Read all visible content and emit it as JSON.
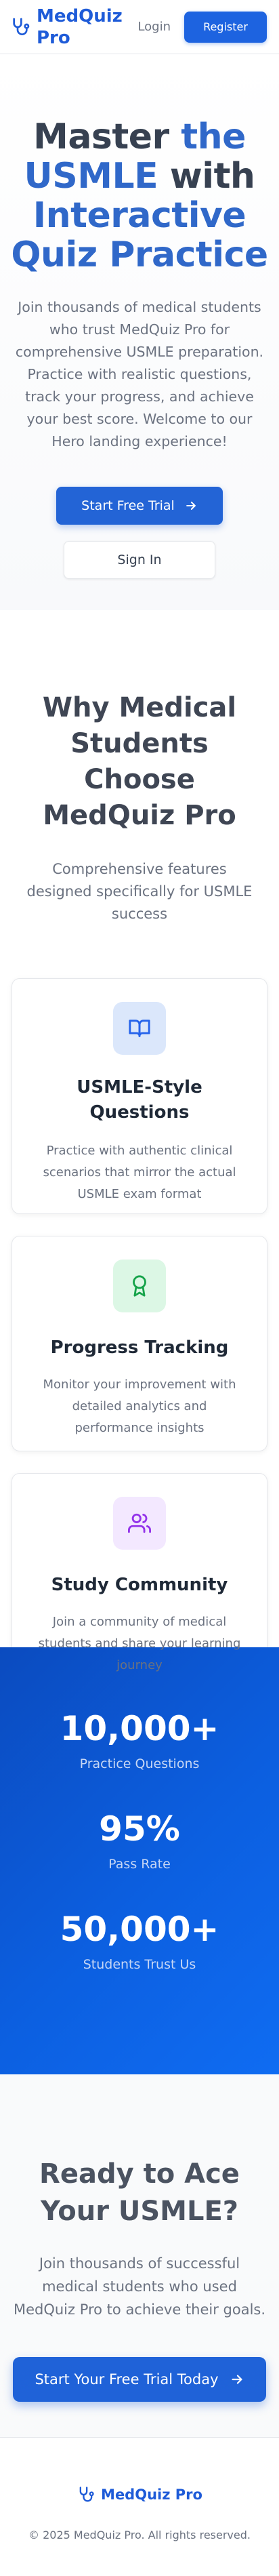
{
  "header": {
    "brand_name": "MedQuiz Pro",
    "login_label": "Login",
    "register_label": "Register"
  },
  "hero": {
    "title_line1_a": "Master ",
    "title_line1_b": "the",
    "title_line2_a": "USMLE",
    "title_line2_b": " with",
    "title_line3": "Interactive",
    "title_line4": "Quiz Practice",
    "subtitle": "Join thousands of medical students who trust MedQuiz Pro for comprehensive USMLE preparation. Practice with realistic questions, track your progress, and achieve your best score. Welcome to our Hero landing experience!",
    "primary_cta": "Start Free Trial",
    "secondary_cta": "Sign In"
  },
  "features": {
    "title": "Why Medical Students Choose MedQuiz Pro",
    "subtitle": "Comprehensive features designed specifically for USMLE success",
    "cards": [
      {
        "icon": "book-open-icon",
        "title": "USMLE-Style Questions",
        "description": "Practice with authentic clinical scenarios that mirror the actual USMLE exam format"
      },
      {
        "icon": "award-icon",
        "title": "Progress Tracking",
        "description": "Monitor your improvement with detailed analytics and performance insights"
      },
      {
        "icon": "users-icon",
        "title": "Study Community",
        "description": "Join a community of medical students and share your learning journey"
      }
    ]
  },
  "stats": [
    {
      "value": "10,000+",
      "label": "Practice Questions"
    },
    {
      "value": "95%",
      "label": "Pass Rate"
    },
    {
      "value": "50,000+",
      "label": "Students Trust Us"
    }
  ],
  "cta": {
    "title": "Ready to Ace Your USMLE?",
    "subtitle": "Join thousands of successful medical students who used MedQuiz Pro to achieve their goals.",
    "button_label": "Start Your Free Trial Today"
  },
  "footer": {
    "brand_name": "MedQuiz Pro",
    "copyright": "© 2025 MedQuiz Pro. All rights reserved."
  },
  "colors": {
    "brand_blue": "#1e5bd8",
    "stats_bg": "#0c5fe0",
    "feature1_icon_bg": "#dbe7fb",
    "feature2_icon_bg": "#dcf7e5",
    "feature3_icon_bg": "#f3e8ff"
  }
}
